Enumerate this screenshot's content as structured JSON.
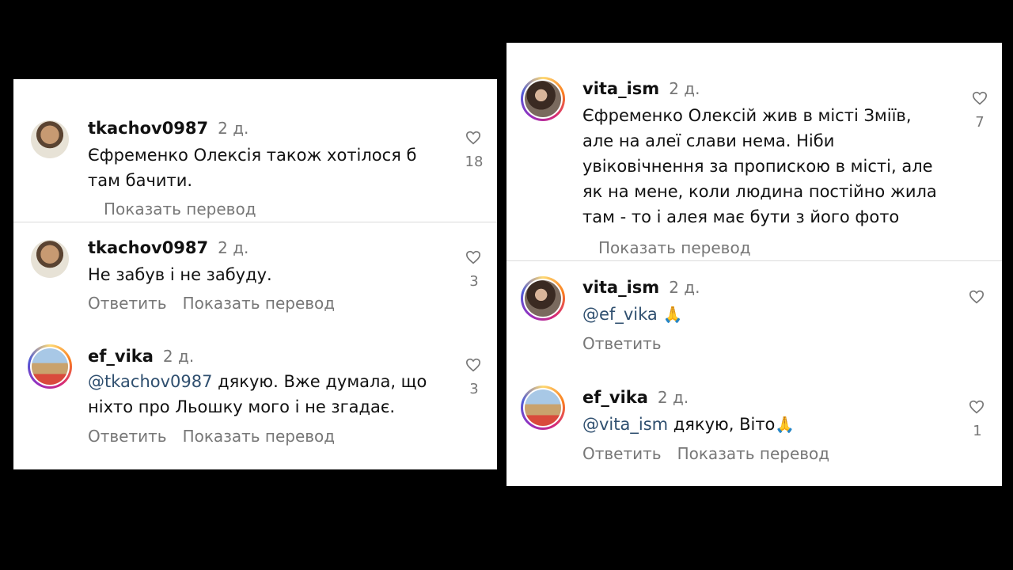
{
  "left": {
    "comments": [
      {
        "username": "tkachov0987",
        "time": "2 д.",
        "lines": [
          "Єфременко Олексія також хотілося б",
          "там бачити."
        ],
        "likes": "18",
        "action_translate": "Показать перевод"
      },
      {
        "username": "tkachov0987",
        "time": "2 д.",
        "lines": [
          "Не забув і не забуду."
        ],
        "likes": "3",
        "action_reply": "Ответить",
        "action_translate": "Показать перевод"
      },
      {
        "username": "ef_vika",
        "time": "2 д.",
        "mention": "@tkachov0987",
        "line1_rest": " дякую. Вже думала, що",
        "line2": "ніхто про Льошку мого і не згадає.",
        "likes": "3",
        "action_reply": "Ответить",
        "action_translate": "Показать перевод"
      }
    ]
  },
  "right": {
    "comments": [
      {
        "username": "vita_ism",
        "time": "2 д.",
        "lines": [
          "Єфременко Олексій жив в місті Зміїв,",
          "але на алеї слави нема. Ніби",
          "увіковічнення за пропискою в місті, але",
          "як на мене, коли людина постійно жила",
          "там - то і алея має бути з його фото"
        ],
        "likes": "7",
        "action_translate": "Показать перевод"
      },
      {
        "username": "vita_ism",
        "time": "2 д.",
        "mention": "@ef_vika",
        "emoji": "🙏",
        "action_reply": "Ответить"
      },
      {
        "username": "ef_vika",
        "time": "2 д.",
        "mention": "@vita_ism",
        "rest": " дякую, Віто",
        "emoji": "🙏",
        "likes": "1",
        "action_reply": "Ответить",
        "action_translate": "Показать перевод"
      }
    ]
  },
  "icons": {
    "like": "heart-icon"
  },
  "colors": {
    "mention": "#2f4f6f",
    "muted": "#777777",
    "divider": "#dbdbdb"
  }
}
